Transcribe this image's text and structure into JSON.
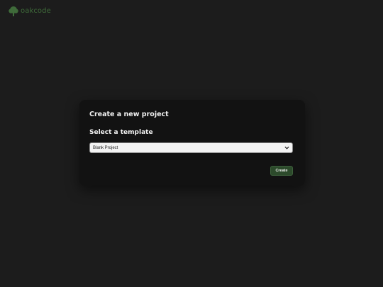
{
  "brand": {
    "name": "oakcode",
    "logo_icon": "oak-tree-icon",
    "color": "#3f6b3a"
  },
  "dialog": {
    "title": "Create a new project",
    "template_label": "Select a template",
    "template_select": {
      "selected": "Blank Project",
      "icon": "chevron-down-icon"
    },
    "create_label": "Create",
    "accent_color": "#2c4a2b"
  }
}
